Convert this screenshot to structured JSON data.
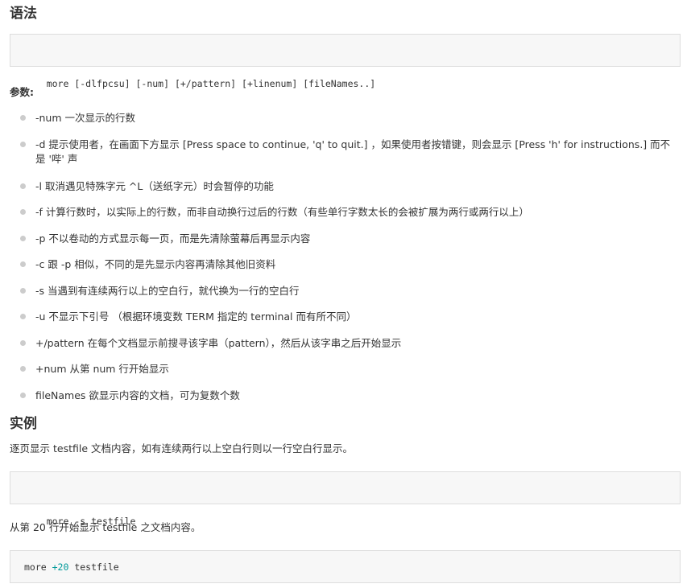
{
  "syntax": {
    "heading": "语法",
    "code": "more [-dlfpcsu] [-num] [+/pattern] [+linenum] [fileNames..]"
  },
  "params": {
    "heading": "参数:",
    "items": [
      "-num 一次显示的行数",
      "-d 提示使用者，在画面下方显示 [Press space to continue, 'q' to quit.] ，如果使用者按错键，则会显示 [Press 'h' for instructions.] 而不是 '哔' 声",
      "-l 取消遇见特殊字元 ^L（送纸字元）时会暂停的功能",
      "-f 计算行数时，以实际上的行数，而非自动换行过后的行数（有些单行字数太长的会被扩展为两行或两行以上）",
      "-p 不以卷动的方式显示每一页，而是先清除萤幕后再显示内容",
      "-c 跟 -p 相似，不同的是先显示内容再清除其他旧资料",
      "-s 当遇到有连续两行以上的空白行，就代换为一行的空白行",
      "-u 不显示下引号 （根据环境变数 TERM 指定的 terminal 而有所不同）",
      "+/pattern 在每个文档显示前搜寻该字串（pattern），然后从该字串之后开始显示",
      "+num 从第 num 行开始显示",
      "fileNames 欲显示内容的文档，可为复数个数"
    ]
  },
  "examples": {
    "heading": "实例",
    "ex1_desc": "逐页显示 testfile 文档内容，如有连续两行以上空白行则以一行空白行显示。",
    "ex1_code": "more -s testfile",
    "ex2_desc": "从第 20 行开始显示 testfile 之文档内容。",
    "ex2_code_cmd": "more ",
    "ex2_code_num": "+20",
    "ex2_code_file": " testfile"
  }
}
